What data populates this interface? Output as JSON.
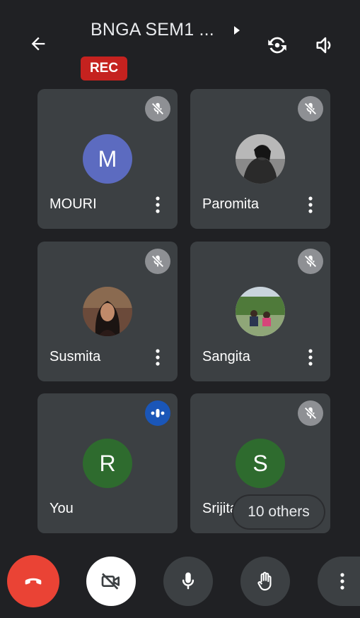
{
  "header": {
    "title": "BNGA SEM1 ...",
    "rec_badge": "REC"
  },
  "icons": {
    "back": "arrow-left-icon",
    "title_chevron": "chevron-right-icon",
    "flip_camera": "flip-camera-icon",
    "speaker": "speaker-icon",
    "muted": "mic-off-icon",
    "speaking": "audio-level-icon",
    "more": "more-vertical-icon",
    "end_call": "end-call-icon",
    "camera_off": "camera-off-icon",
    "mic": "mic-icon",
    "raise_hand": "raise-hand-icon"
  },
  "participants": [
    {
      "name": "MOURI",
      "initial": "M",
      "avatar_color": "#5c6bc0",
      "status": "muted"
    },
    {
      "name": "Paromita",
      "initial": "",
      "avatar_color": "#3a3a3a",
      "status": "muted"
    },
    {
      "name": "Susmita",
      "initial": "",
      "avatar_color": "#4a2f2a",
      "status": "muted"
    },
    {
      "name": "Sangita",
      "initial": "",
      "avatar_color": "#556b3a",
      "status": "muted"
    },
    {
      "name": "You",
      "initial": "R",
      "avatar_color": "#2e6b2e",
      "status": "speaking"
    },
    {
      "name": "Srijita",
      "initial": "S",
      "avatar_color": "#2e6b2e",
      "status": "muted"
    }
  ],
  "others_label": "10 others",
  "colors": {
    "background": "#202124",
    "tile": "#3c4043",
    "rec": "#c5221f",
    "end_call": "#ea4335",
    "speaking": "#1a56b8"
  }
}
